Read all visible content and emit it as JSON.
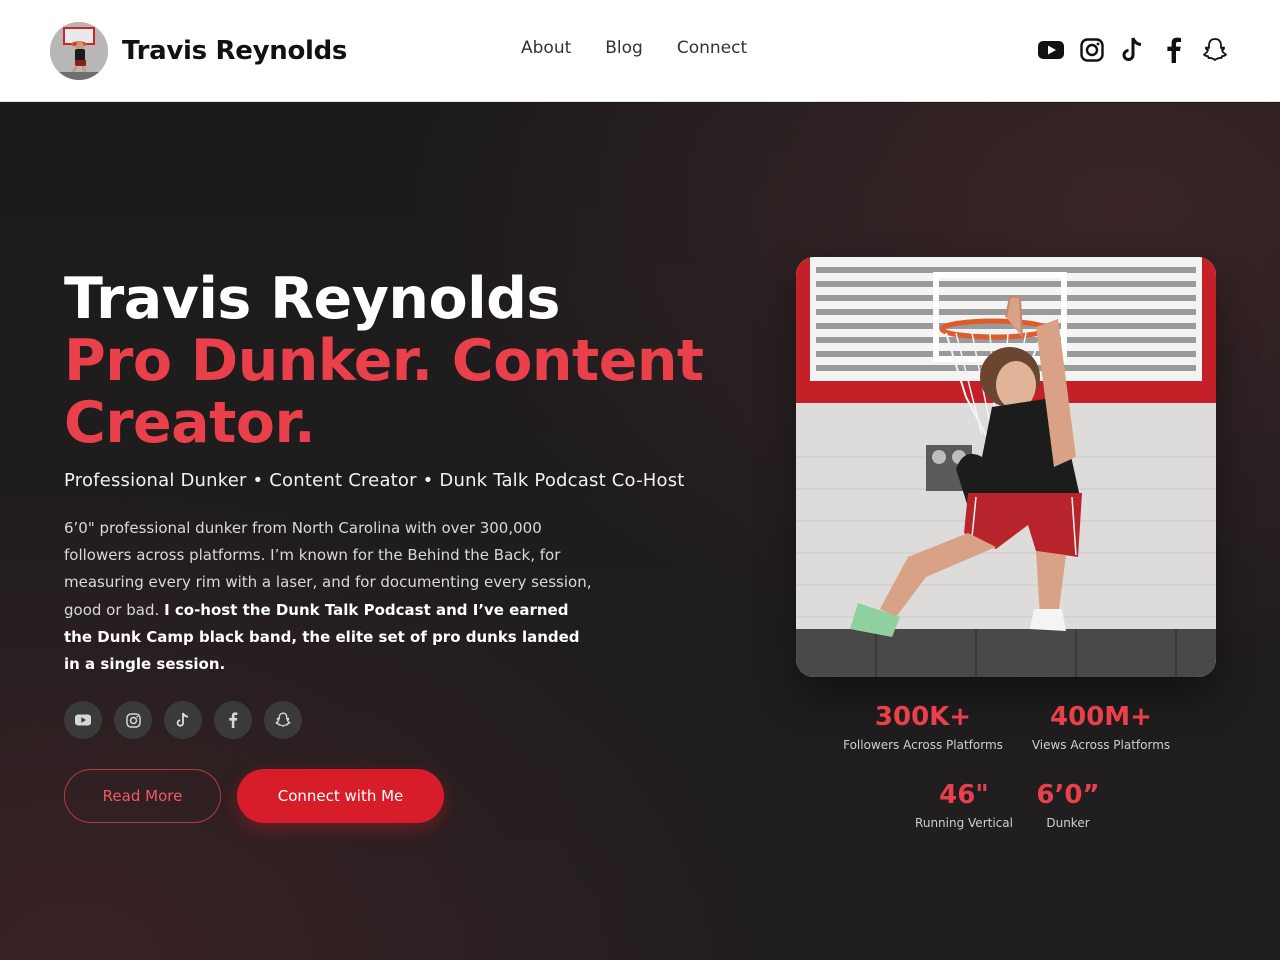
{
  "header": {
    "brand_name": "Travis Reynolds",
    "nav": [
      {
        "label": "About"
      },
      {
        "label": "Blog"
      },
      {
        "label": "Connect"
      }
    ],
    "social_icons": [
      "youtube-icon",
      "instagram-icon",
      "tiktok-icon",
      "facebook-icon",
      "snapchat-icon"
    ]
  },
  "hero": {
    "name": "Travis Reynolds",
    "headline": "Pro Dunker. Content Creator.",
    "subtitle": "Professional Dunker • Content Creator • Dunk Talk Podcast Co-Host",
    "bio_plain": "6’0\" professional dunker from North Carolina with over 300,000 followers across platforms. I’m known for the Behind the Back, for measuring every rim with a laser, and for documenting every session, good or bad.",
    "bio_bold": "I co-host the Dunk Talk Podcast and I’ve earned the Dunk Camp black band, the elite set of pro dunks landed in a single session.",
    "buttons": {
      "read_more": "Read More",
      "connect": "Connect with Me"
    }
  },
  "stats": [
    {
      "value": "300K+",
      "label": "Followers Across Platforms"
    },
    {
      "value": "400M+",
      "label": "Views Across Platforms"
    },
    {
      "value": "46\"",
      "label": "Running Vertical"
    },
    {
      "value": "6’0”",
      "label": "Dunker"
    }
  ],
  "colors": {
    "accent": "#e9404b",
    "button_red": "#d81d2a",
    "background": "#1c1b1c"
  }
}
